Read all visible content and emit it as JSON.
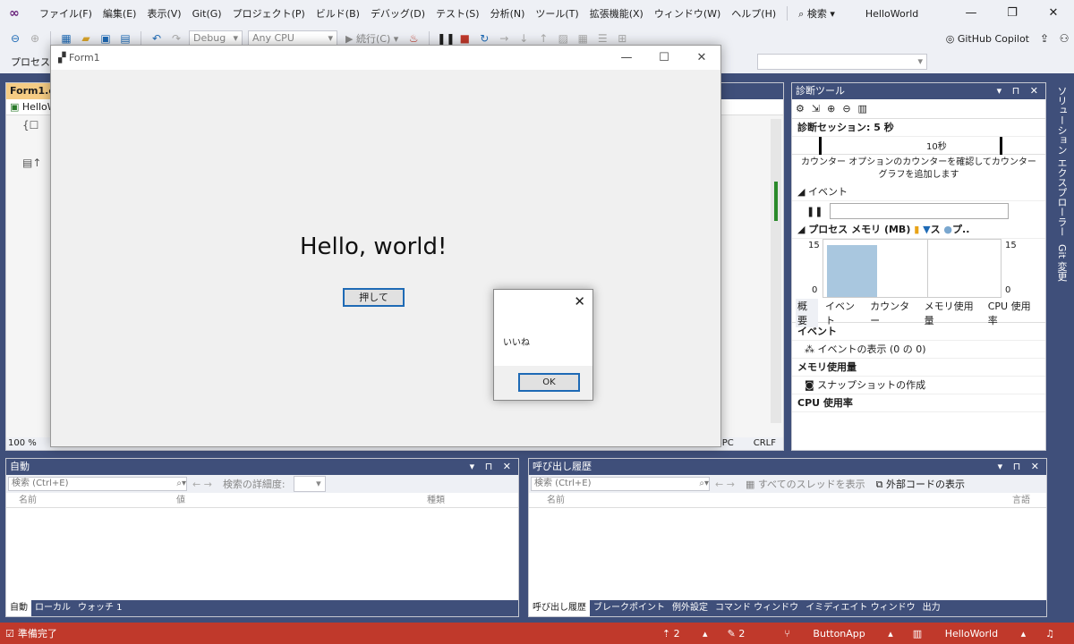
{
  "menubar": {
    "items": [
      "ファイル(F)",
      "編集(E)",
      "表示(V)",
      "Git(G)",
      "プロジェクト(P)",
      "ビルド(B)",
      "デバッグ(D)",
      "テスト(S)",
      "分析(N)",
      "ツール(T)",
      "拡張機能(X)",
      "ウィンドウ(W)",
      "ヘルプ(H)"
    ],
    "search_label": "検索",
    "solution_title": "HelloWorld"
  },
  "toolbar": {
    "config": "Debug",
    "platform": "Any CPU",
    "continue_label": "続行(C)",
    "copilot_label": "GitHub Copilot",
    "process_label": "プロセス"
  },
  "editor": {
    "tab_label": "Form1.cs",
    "nav_label": "HelloW",
    "zoom": "100 %",
    "status_spc": "SPC",
    "status_crlf": "CRLF"
  },
  "form1": {
    "title": "Form1",
    "heading": "Hello, world!",
    "button_label": "押して"
  },
  "msgbox": {
    "text": "いいね",
    "ok_label": "OK"
  },
  "diagnostics": {
    "title": "診断ツール",
    "session": "診断セッション: 5 秒",
    "timeline_label": "10秒",
    "counter_hint": "カウンター オプションのカウンターを確認してカウンター グラフを追加します",
    "events_section": "イベント",
    "memory_section": "プロセス メモリ (MB)",
    "legend_a": "ス",
    "legend_b": "プ..",
    "y_max": "15",
    "y_min": "0",
    "tabs": [
      "概要",
      "イベント",
      "カウンター",
      "メモリ使用量",
      "CPU 使用率"
    ],
    "events_header": "イベント",
    "events_show": "イベントの表示 (0 の 0)",
    "memory_header": "メモリ使用量",
    "snapshot": "スナップショットの作成",
    "cpu_header": "CPU 使用率"
  },
  "sidetabs": [
    "ソリューション エクスプローラー",
    "Git 変更"
  ],
  "autos": {
    "title": "自動",
    "search_placeholder": "検索 (Ctrl+E)",
    "depth_label": "検索の詳細度:",
    "columns": [
      "名前",
      "値",
      "種類"
    ],
    "tabs": [
      "自動",
      "ローカル",
      "ウォッチ 1"
    ]
  },
  "callstack": {
    "title": "呼び出し履歴",
    "search_placeholder": "検索 (Ctrl+E)",
    "all_threads": "すべてのスレッドを表示",
    "external_code": "外部コードの表示",
    "columns": [
      "名前",
      "言語"
    ],
    "tabs": [
      "呼び出し履歴",
      "ブレークポイント",
      "例外設定",
      "コマンド ウィンドウ",
      "イミディエイト ウィンドウ",
      "出力"
    ]
  },
  "status": {
    "ready": "準備完了",
    "up_count": "2",
    "pencil_count": "2",
    "branch": "ButtonApp",
    "repo": "HelloWorld"
  }
}
